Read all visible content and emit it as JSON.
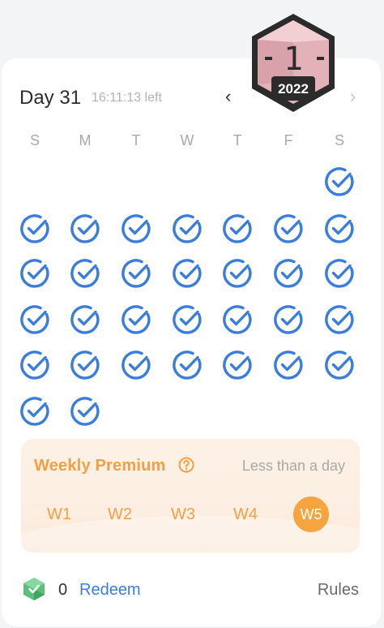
{
  "badge": {
    "number": "1",
    "year": "2022",
    "colors": {
      "face": "#e8b8be",
      "frame": "#2b2b2b"
    }
  },
  "header": {
    "day_title": "Day 31",
    "time_left": "16:11:13 left",
    "prev_icon": "‹",
    "next_icon": "›"
  },
  "weekdays": [
    "S",
    "M",
    "T",
    "W",
    "T",
    "F",
    "S"
  ],
  "calendar": {
    "checked_days": 31,
    "status_icon": "check-circle-icon",
    "check_color": "#3b7ddd"
  },
  "premium": {
    "title": "Weekly Premium",
    "help_icon": "question-circle-icon",
    "status": "Less than a day",
    "weeks": [
      "W1",
      "W2",
      "W3",
      "W4",
      "W5"
    ],
    "active_week": "W5",
    "accent_color": "#f0a045"
  },
  "footer": {
    "gem_icon": "green-gem-icon",
    "points": "0",
    "redeem_label": "Redeem",
    "rules_label": "Rules",
    "link_color": "#3b7ddd"
  }
}
